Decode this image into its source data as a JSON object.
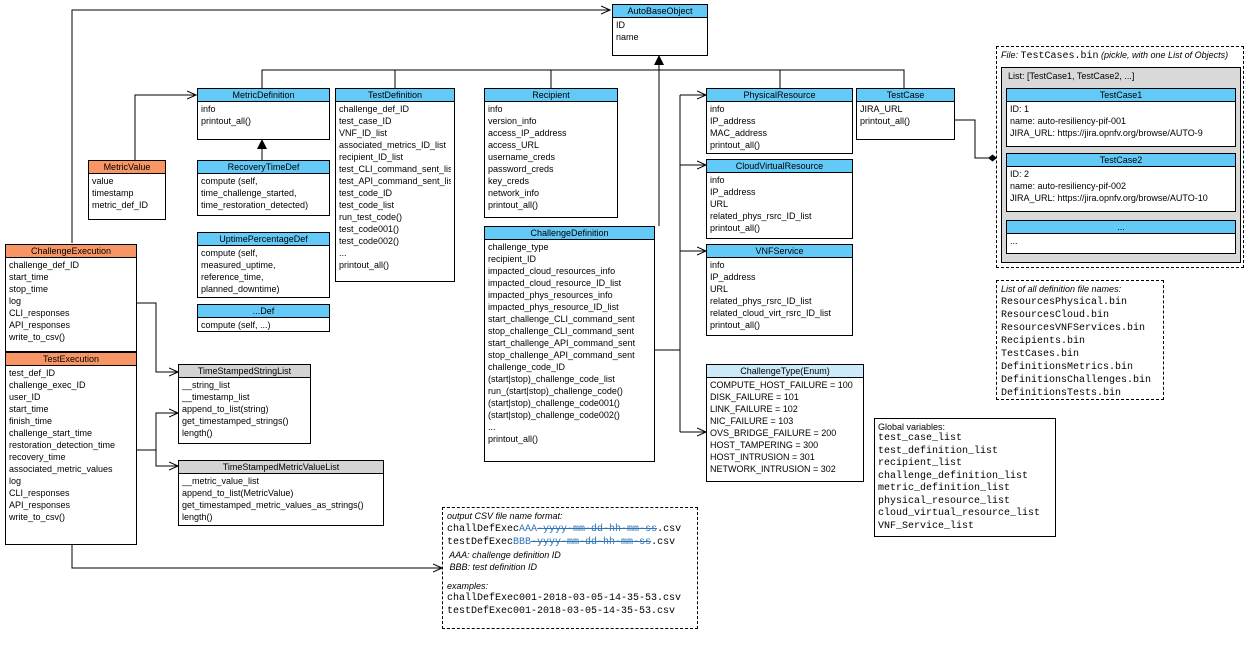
{
  "auto_base_object": {
    "title": "AutoBaseObject",
    "fields": [
      "ID",
      "name"
    ]
  },
  "metric_definition": {
    "title": "MetricDefinition",
    "fields": [
      "info",
      "printout_all()"
    ]
  },
  "metric_value": {
    "title": "MetricValue",
    "fields": [
      "value",
      "timestamp",
      "metric_def_ID"
    ]
  },
  "recovery_time_def": {
    "title": "RecoveryTimeDef",
    "fields": [
      "compute (self,",
      "time_challenge_started,",
      "time_restoration_detected)"
    ]
  },
  "uptime_percentage_def": {
    "title": "UptimePercentageDef",
    "fields": [
      "compute (self,",
      "measured_uptime,",
      "reference_time,",
      "planned_downtime)"
    ]
  },
  "def_other": {
    "title": "...Def",
    "fields": [
      "compute (self, ...)"
    ]
  },
  "test_definition": {
    "title": "TestDefinition",
    "fields": [
      "challenge_def_ID",
      "test_case_ID",
      "VNF_ID_list",
      "associated_metrics_ID_list",
      "recipient_ID_list",
      "test_CLI_command_sent_list",
      "test_API_command_sent_list",
      "test_code_ID",
      "test_code_list",
      "run_test_code()",
      "test_code001()",
      "test_code002()",
      "...",
      "printout_all()"
    ]
  },
  "recipient": {
    "title": "Recipient",
    "fields": [
      "info",
      "version_info",
      "access_IP_address",
      "access_URL",
      "username_creds",
      "password_creds",
      "key_creds",
      "network_info",
      "printout_all()"
    ]
  },
  "challenge_definition": {
    "title": "ChallengeDefinition",
    "fields": [
      "challenge_type",
      "recipient_ID",
      "impacted_cloud_resources_info",
      "impacted_cloud_resource_ID_list",
      "impacted_phys_resources_info",
      "impacted_phys_resource_ID_list",
      "start_challenge_CLI_command_sent",
      "stop_challenge_CLI_command_sent",
      "start_challenge_API_command_sent",
      "stop_challenge_API_command_sent",
      "challenge_code_ID",
      "(start|stop)_challenge_code_list",
      "run_(start|stop)_challenge_code()",
      "(start|stop)_challenge_code001()",
      "(start|stop)_challenge_code002()",
      "...",
      "printout_all()"
    ]
  },
  "physical_resource": {
    "title": "PhysicalResource",
    "fields": [
      "info",
      "IP_address",
      "MAC_address",
      "printout_all()"
    ]
  },
  "cloud_virtual_resource": {
    "title": "CloudVirtualResource",
    "fields": [
      "info",
      "IP_address",
      "URL",
      "related_phys_rsrc_ID_list",
      "printout_all()"
    ]
  },
  "vnf_service": {
    "title": "VNFService",
    "fields": [
      "info",
      "IP_address",
      "URL",
      "related_phys_rsrc_ID_list",
      "related_cloud_virt_rsrc_ID_list",
      "printout_all()"
    ]
  },
  "challenge_type": {
    "title": "ChallengeType(Enum)",
    "fields": [
      "COMPUTE_HOST_FAILURE = 100",
      "DISK_FAILURE = 101",
      "LINK_FAILURE = 102",
      "NIC_FAILURE = 103",
      "OVS_BRIDGE_FAILURE = 200",
      "HOST_TAMPERING = 300",
      "HOST_INTRUSION = 301",
      "NETWORK_INTRUSION = 302"
    ]
  },
  "test_case": {
    "title": "TestCase",
    "fields": [
      "JIRA_URL",
      "printout_all()"
    ]
  },
  "challenge_execution": {
    "title": "ChallengeExecution",
    "fields": [
      "challenge_def_ID",
      "start_time",
      "stop_time",
      "log",
      "CLI_responses",
      "API_responses",
      "write_to_csv()"
    ]
  },
  "test_execution": {
    "title": "TestExecution",
    "fields": [
      "test_def_ID",
      "challenge_exec_ID",
      "user_ID",
      "start_time",
      "finish_time",
      "challenge_start_time",
      "restoration_detection_time",
      "recovery_time",
      "associated_metric_values",
      "log",
      "CLI_responses",
      "API_responses",
      "write_to_csv()"
    ]
  },
  "timestamped_string_list": {
    "title": "TimeStampedStringList",
    "fields": [
      "__string_list",
      "__timestamp_list",
      "append_to_list(string)",
      "get_timestamped_strings()",
      "length()"
    ]
  },
  "timestamped_metric_value_list": {
    "title": "TimeStampedMetricValueList",
    "fields": [
      "__metric_value_list",
      "append_to_list(MetricValue)",
      "get_timestamped_metric_values_as_strings()",
      "length()"
    ]
  },
  "testcases_file": {
    "file_prefix": "File: ",
    "file_name": "TestCases.bin",
    "file_suffix": " (pickle, with one List of Objects)",
    "list_label": "List: [TestCase1, TestCase2, ...]",
    "tc1": {
      "title": "TestCase1",
      "fields": [
        "ID: 1",
        "name: auto-resiliency-pif-001",
        "JIRA_URL: https://jira.opnfv.org/browse/AUTO-9"
      ]
    },
    "tc2": {
      "title": "TestCase2",
      "fields": [
        "ID: 2",
        "name: auto-resiliency-pif-002",
        "JIRA_URL: https://jira.opnfv.org/browse/AUTO-10"
      ]
    },
    "tc3": {
      "title": "...",
      "fields": [
        "..."
      ]
    }
  },
  "definition_files": {
    "heading": "List of all definition file names:",
    "files": [
      "ResourcesPhysical.bin",
      "ResourcesCloud.bin",
      "ResourcesVNFServices.bin",
      "Recipients.bin",
      "TestCases.bin",
      "DefinitionsMetrics.bin",
      "DefinitionsChallenges.bin",
      "DefinitionsTests.bin"
    ]
  },
  "global_variables": {
    "heading": "Global variables:",
    "vars": [
      "test_case_list",
      "test_definition_list",
      "recipient_list",
      "challenge_definition_list",
      "metric_definition_list",
      "physical_resource_list",
      "cloud_virtual_resource_list",
      "VNF_Service_list"
    ]
  },
  "csv_note": {
    "heading": "output CSV file name format:",
    "line1": {
      "a": "challDefExec",
      "b": "AAA",
      "c": "-",
      "d": "yyyy-mm-dd-hh-mm-ss",
      "e": ".csv"
    },
    "line2": {
      "a": "testDefExec",
      "b": "BBB",
      "c": "-",
      "d": "yyyy-mm-dd-hh-mm-ss",
      "e": ".csv"
    },
    "aaa": " AAA: challenge definition ID",
    "bbb": " BBB: test definition ID",
    "examples_heading": "examples:",
    "examples": [
      "challDefExec001-2018-03-05-14-35-53.csv",
      "testDefExec001-2018-03-05-14-35-53.csv"
    ]
  }
}
